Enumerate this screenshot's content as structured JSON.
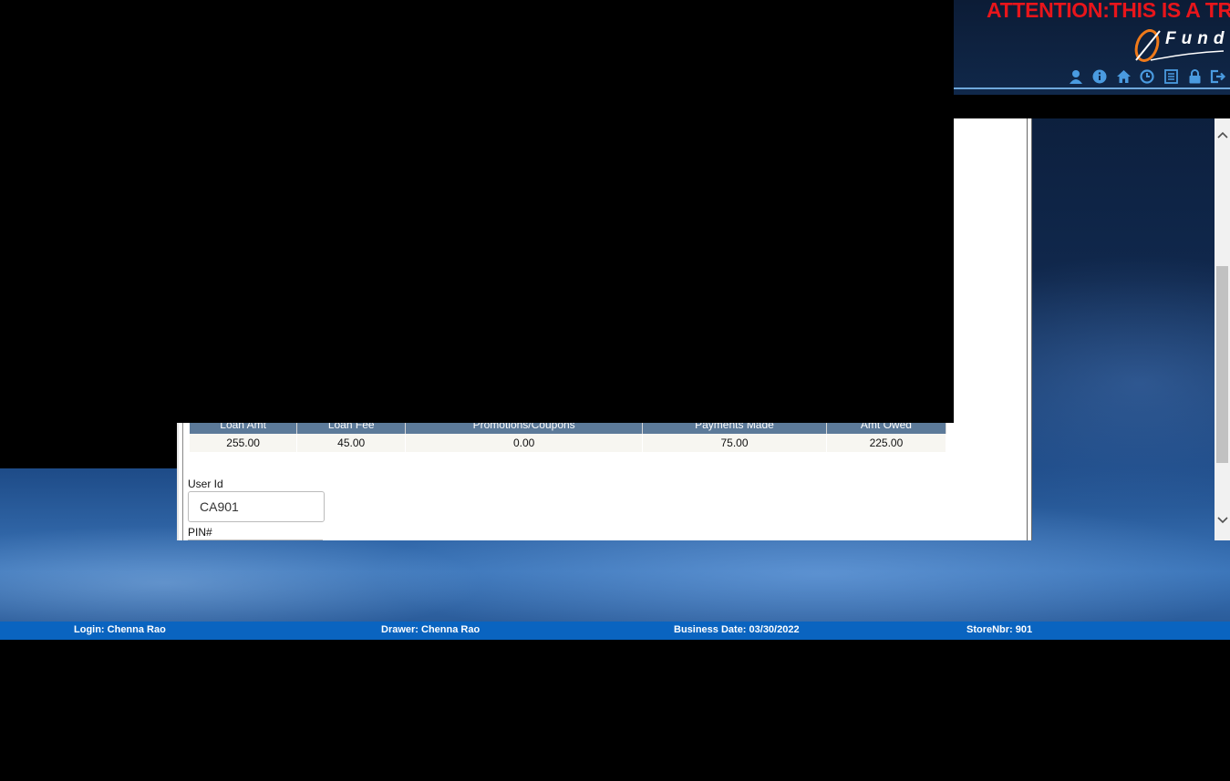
{
  "header": {
    "attention_text": "ATTENTION:THIS IS A TRA",
    "logo_text": "Fund",
    "icons": [
      "user-icon",
      "info-icon",
      "home-icon",
      "clock-icon",
      "list-icon",
      "lock-icon",
      "logout-icon"
    ],
    "accent_color": "#4a9be0",
    "attention_color": "#e8151b"
  },
  "loan_table": {
    "columns": [
      "Loan Amt",
      "Loan Fee",
      "Promotions/Coupons",
      "Payments Made",
      "Amt Owed"
    ],
    "rows": [
      [
        "255.00",
        "45.00",
        "0.00",
        "75.00",
        "225.00"
      ]
    ]
  },
  "form": {
    "user_id_label": "User Id",
    "user_id_value": "CA901",
    "pin_label": "PIN#"
  },
  "status_bar": {
    "login": "Login: Chenna Rao",
    "drawer": "Drawer: Chenna Rao",
    "business_date": "Business Date: 03/30/2022",
    "store": "StoreNbr: 901",
    "color": "#0a64c0"
  }
}
